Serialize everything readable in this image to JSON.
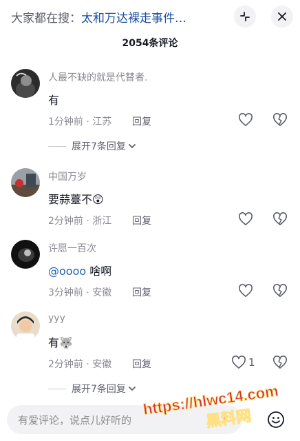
{
  "header": {
    "prefix": "大家都在搜：",
    "topic": "太和万达裸走事件…",
    "comment_count": "2054条评论"
  },
  "comments": [
    {
      "username": "人最不缺的就是代替者.",
      "text": "有",
      "meta": "1分钟前 · 江苏",
      "reply": "回复",
      "likes": "",
      "expand": "展开7条回复"
    },
    {
      "username": "中国万岁",
      "text": "要蒜薹不",
      "emoji": "😲",
      "meta": "2分钟前 · 浙江",
      "reply": "回复",
      "likes": ""
    },
    {
      "username": "许愿一百次",
      "mention": "@oooo",
      "text": " 啥啊",
      "meta": "3分钟前 · 安徽",
      "reply": "回复",
      "likes": ""
    },
    {
      "username": "yyy",
      "text": "有",
      "emoji": "🐺",
      "meta": "2分钟前 · 安徽",
      "reply": "回复",
      "likes": "1",
      "expand": "展开7条回复"
    }
  ],
  "input": {
    "placeholder": "有爱评论，说点儿好听的"
  },
  "watermark": {
    "line1": "https://hlwc14.com",
    "line2": "黑料网"
  },
  "icons": {
    "minimize": "minimize-icon",
    "close": "close-icon",
    "like": "heart-icon",
    "dislike": "broken-heart-icon",
    "chevron": "chevron-down-icon",
    "emoji": "smiley-icon"
  }
}
